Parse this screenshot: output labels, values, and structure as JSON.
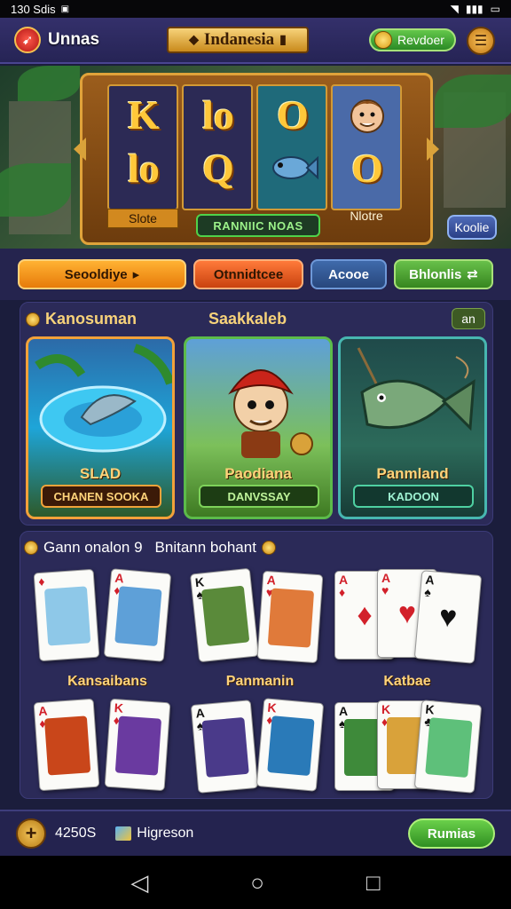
{
  "status_bar": {
    "time": "130 Sdis",
    "icons": [
      "wifi-icon",
      "signal-icon",
      "battery-icon"
    ]
  },
  "header": {
    "brand": "Unnas",
    "title": "Indanesia",
    "coin_label": "Revdoer",
    "menu_icon": "menu-icon"
  },
  "hero": {
    "reels": [
      {
        "top": "K",
        "bottom": "lo",
        "label": "Slote"
      },
      {
        "top": "lo",
        "bottom": "Q",
        "label": ""
      },
      {
        "top": "O",
        "bottom": "fish",
        "label": ""
      },
      {
        "top": "face",
        "bottom": "O",
        "label": "Nlotre"
      }
    ],
    "spin_badge": "RANNIIC NOAS",
    "side_button": "Koolie"
  },
  "filters": [
    {
      "label": "Seooldiye",
      "suffix": "▸"
    },
    {
      "label": "Otnnidtcee"
    },
    {
      "label": "Acooe"
    },
    {
      "label": "Bhlonlis",
      "suffix": "⇄"
    }
  ],
  "featured": {
    "left_title": "Kanosuman",
    "mid_title": "Saakkaleb",
    "pill": "an",
    "games": [
      {
        "name": "SLAD",
        "sub": "CHANEN SOOKA",
        "theme": "#f2a13a"
      },
      {
        "name": "Paodiana",
        "sub": "DANVSSAY",
        "theme": "#5cbb4a"
      },
      {
        "name": "Panmland",
        "sub": "KADOON",
        "theme": "#47b6b0"
      }
    ]
  },
  "cards_section": {
    "title": "Gann onalon 9",
    "subtitle": "Bnitann bohant",
    "groups": [
      {
        "label": "Kansaibans"
      },
      {
        "label": "Panmanin"
      },
      {
        "label": "Katbae"
      }
    ]
  },
  "bottom_bar": {
    "balance": "4250S",
    "progress": "Higreson",
    "action": "Rumias"
  },
  "nav": {
    "back": "◁",
    "home": "○",
    "recents": "□"
  }
}
